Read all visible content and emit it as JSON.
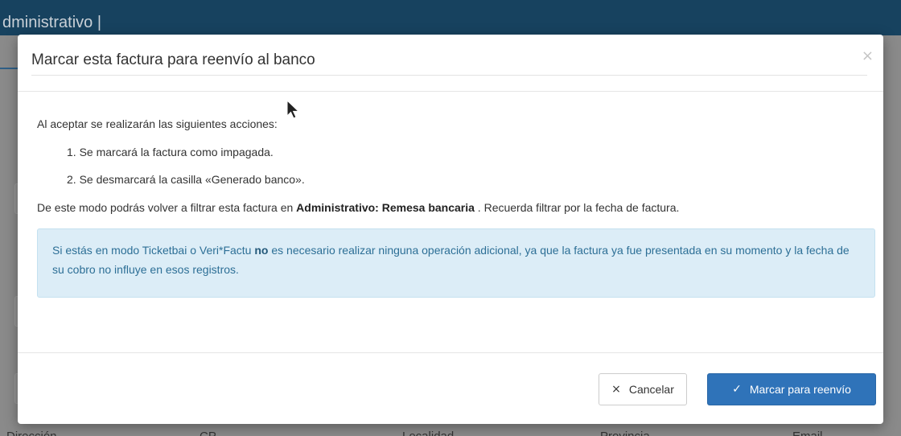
{
  "app": {
    "title": "dministrativo |",
    "footer_columns": [
      "Dirección",
      "CP",
      "Localidad",
      "Provincia",
      "Email"
    ]
  },
  "modal": {
    "title": "Marcar esta factura para reenvío al banco",
    "close_label": "×",
    "intro": "Al aceptar se realizarán las siguientes acciones:",
    "steps": [
      "1. Se marcará la factura como impagada.",
      "2. Se desmarcará la casilla «Generado banco»."
    ],
    "description": {
      "before": "De este modo podrás volver a filtrar esta factura en ",
      "bold": "Administrativo: Remesa bancaria",
      "after": " . Recuerda filtrar por la fecha de factura."
    },
    "alert": {
      "before": "Si estás en modo Ticketbai o Veri*Factu ",
      "bold": "no",
      "after": " es necesario realizar ninguna operación adicional, ya que la factura ya fue presentada en su momento y la fecha de su cobro no influye en esos registros."
    },
    "buttons": {
      "cancel_icon": "×",
      "cancel_label": "Cancelar",
      "confirm_icon": "✓",
      "confirm_label": "Marcar para reenvío"
    }
  },
  "colors": {
    "topbar": "#17425f",
    "primary": "#2f73b9",
    "alert_bg": "#dcedf7",
    "alert_text": "#2d6f96"
  },
  "icons": {
    "close": "close-icon",
    "cancel": "close-icon",
    "confirm": "check-icon",
    "cursor": "mouse-cursor-icon"
  }
}
